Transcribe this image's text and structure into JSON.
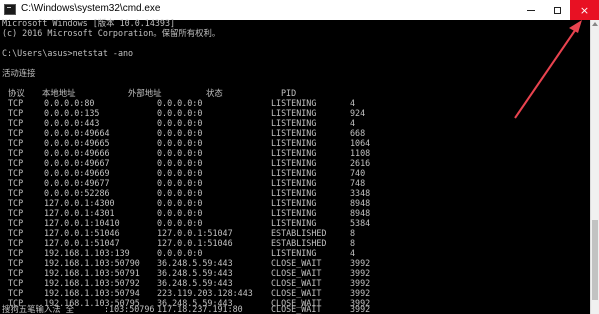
{
  "window": {
    "title": "C:\\Windows\\system32\\cmd.exe",
    "min_label": "",
    "max_label": "",
    "close_label": "×"
  },
  "console": {
    "header": [
      "Microsoft Windows [版本 10.0.14393]",
      "(c) 2016 Microsoft Corporation。保留所有权利。",
      "",
      "C:\\Users\\asus>netstat -ano",
      "",
      "活动连接"
    ],
    "columns": [
      "协议",
      "本地地址",
      "外部地址",
      "状态",
      "PID"
    ],
    "rows": [
      [
        "TCP",
        "0.0.0.0:80",
        "0.0.0.0:0",
        "LISTENING",
        "4"
      ],
      [
        "TCP",
        "0.0.0.0:135",
        "0.0.0.0:0",
        "LISTENING",
        "924"
      ],
      [
        "TCP",
        "0.0.0.0:443",
        "0.0.0.0:0",
        "LISTENING",
        "4"
      ],
      [
        "TCP",
        "0.0.0.0:49664",
        "0.0.0.0:0",
        "LISTENING",
        "668"
      ],
      [
        "TCP",
        "0.0.0.0:49665",
        "0.0.0.0:0",
        "LISTENING",
        "1064"
      ],
      [
        "TCP",
        "0.0.0.0:49666",
        "0.0.0.0:0",
        "LISTENING",
        "1108"
      ],
      [
        "TCP",
        "0.0.0.0:49667",
        "0.0.0.0:0",
        "LISTENING",
        "2616"
      ],
      [
        "TCP",
        "0.0.0.0:49669",
        "0.0.0.0:0",
        "LISTENING",
        "740"
      ],
      [
        "TCP",
        "0.0.0.0:49677",
        "0.0.0.0:0",
        "LISTENING",
        "748"
      ],
      [
        "TCP",
        "0.0.0.0:52286",
        "0.0.0.0:0",
        "LISTENING",
        "3348"
      ],
      [
        "TCP",
        "127.0.0.1:4300",
        "0.0.0.0:0",
        "LISTENING",
        "8948"
      ],
      [
        "TCP",
        "127.0.0.1:4301",
        "0.0.0.0:0",
        "LISTENING",
        "8948"
      ],
      [
        "TCP",
        "127.0.0.1:10410",
        "0.0.0.0:0",
        "LISTENING",
        "5384"
      ],
      [
        "TCP",
        "127.0.0.1:51046",
        "127.0.0.1:51047",
        "ESTABLISHED",
        "8"
      ],
      [
        "TCP",
        "127.0.0.1:51047",
        "127.0.0.1:51046",
        "ESTABLISHED",
        "8"
      ],
      [
        "TCP",
        "192.168.1.103:139",
        "0.0.0.0:0",
        "LISTENING",
        "4"
      ],
      [
        "TCP",
        "192.168.1.103:50790",
        "36.248.5.59:443",
        "CLOSE_WAIT",
        "3992"
      ],
      [
        "TCP",
        "192.168.1.103:50791",
        "36.248.5.59:443",
        "CLOSE_WAIT",
        "3992"
      ],
      [
        "TCP",
        "192.168.1.103:50792",
        "36.248.5.59:443",
        "CLOSE_WAIT",
        "3992"
      ],
      [
        "TCP",
        "192.168.1.103:50794",
        "223.119.203.128:443",
        "CLOSE_WAIT",
        "3992"
      ],
      [
        "TCP",
        "192.168.1.103:50795",
        "36.248.5.59:443",
        "CLOSE_WAIT",
        "3992"
      ],
      [
        "",
        "",
        "",
        "",
        ""
      ]
    ],
    "ime_prefix": "搜狗五笔输入法 全",
    "last_row": [
      ":103:50796",
      "117.18.237.191:80",
      "CLOSE_WAIT",
      "3992"
    ]
  }
}
